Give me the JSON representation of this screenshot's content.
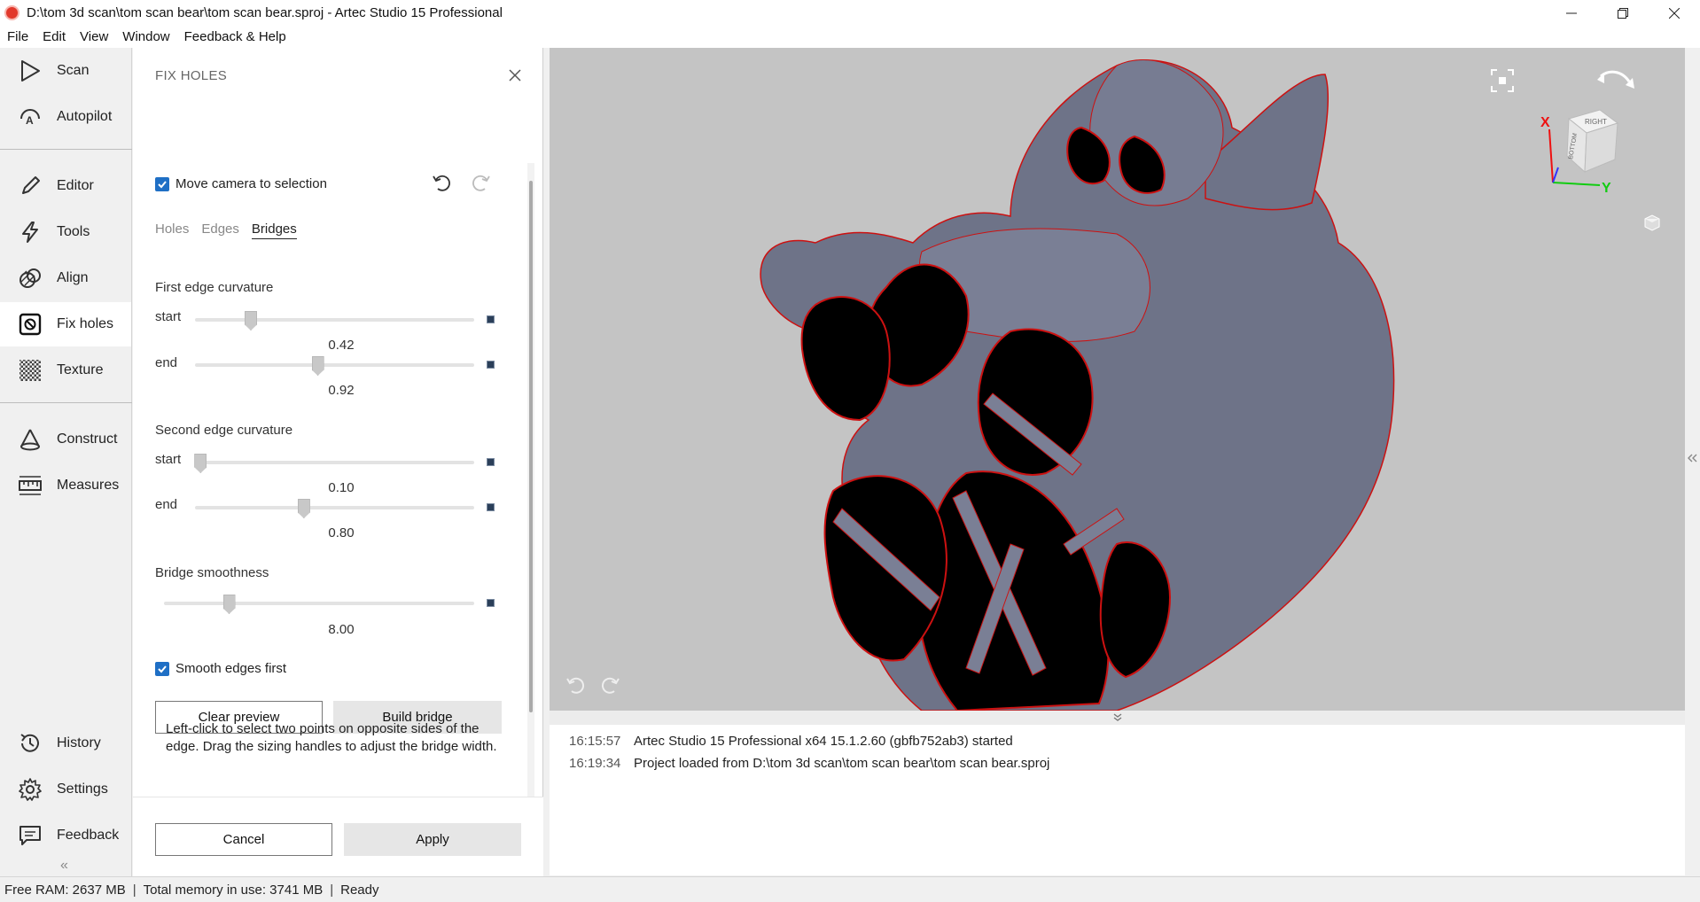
{
  "window": {
    "title": "D:\\tom 3d scan\\tom scan bear\\tom scan bear.sproj - Artec Studio 15 Professional"
  },
  "menu": [
    "File",
    "Edit",
    "View",
    "Window",
    "Feedback & Help"
  ],
  "nav": {
    "scan": "Scan",
    "autopilot": "Autopilot",
    "editor": "Editor",
    "tools": "Tools",
    "align": "Align",
    "fix_holes": "Fix holes",
    "texture": "Texture",
    "construct": "Construct",
    "measures": "Measures",
    "history": "History",
    "settings": "Settings",
    "feedback": "Feedback",
    "collapse": "«"
  },
  "panel": {
    "title": "FIX HOLES",
    "move_camera_label": "Move camera to selection",
    "move_camera_checked": true,
    "tabs": [
      "Holes",
      "Edges",
      "Bridges"
    ],
    "active_tab": "Bridges",
    "first_edge": {
      "title": "First edge curvature",
      "start_label": "start",
      "start_value": "0.42",
      "start_fraction": 0.2,
      "end_label": "end",
      "end_value": "0.92",
      "end_fraction": 0.44
    },
    "second_edge": {
      "title": "Second edge curvature",
      "start_label": "start",
      "start_value": "0.10",
      "start_fraction": 0.02,
      "end_label": "end",
      "end_value": "0.80",
      "end_fraction": 0.39
    },
    "smoothness": {
      "title": "Bridge smoothness",
      "value": "8.00",
      "fraction": 0.21
    },
    "smooth_edges_label": "Smooth edges first",
    "smooth_edges_checked": true,
    "clear_preview": "Clear preview",
    "build_bridge": "Build bridge",
    "help_text": "Left-click to select two points on opposite sides of the edge. Drag the sizing handles to adjust the bridge width.",
    "cancel": "Cancel",
    "apply": "Apply"
  },
  "viewport": {
    "mesh_color": "#6e7388",
    "hole_color": "#000000",
    "edge_color": "#cc1111",
    "axis_x": "X",
    "axis_y": "Y",
    "cube_right": "RIGHT",
    "cube_bottom": "BOTTOM"
  },
  "log": [
    {
      "time": "16:15:57",
      "message": "Artec Studio 15 Professional x64 15.1.2.60 (gbfb752ab3) started"
    },
    {
      "time": "16:19:34",
      "message": "Project loaded from D:\\tom 3d scan\\tom scan bear\\tom scan bear.sproj"
    }
  ],
  "status": {
    "free_ram": "Free RAM: 2637 MB",
    "total_memory": "Total memory in use: 3741 MB",
    "state": "Ready"
  }
}
